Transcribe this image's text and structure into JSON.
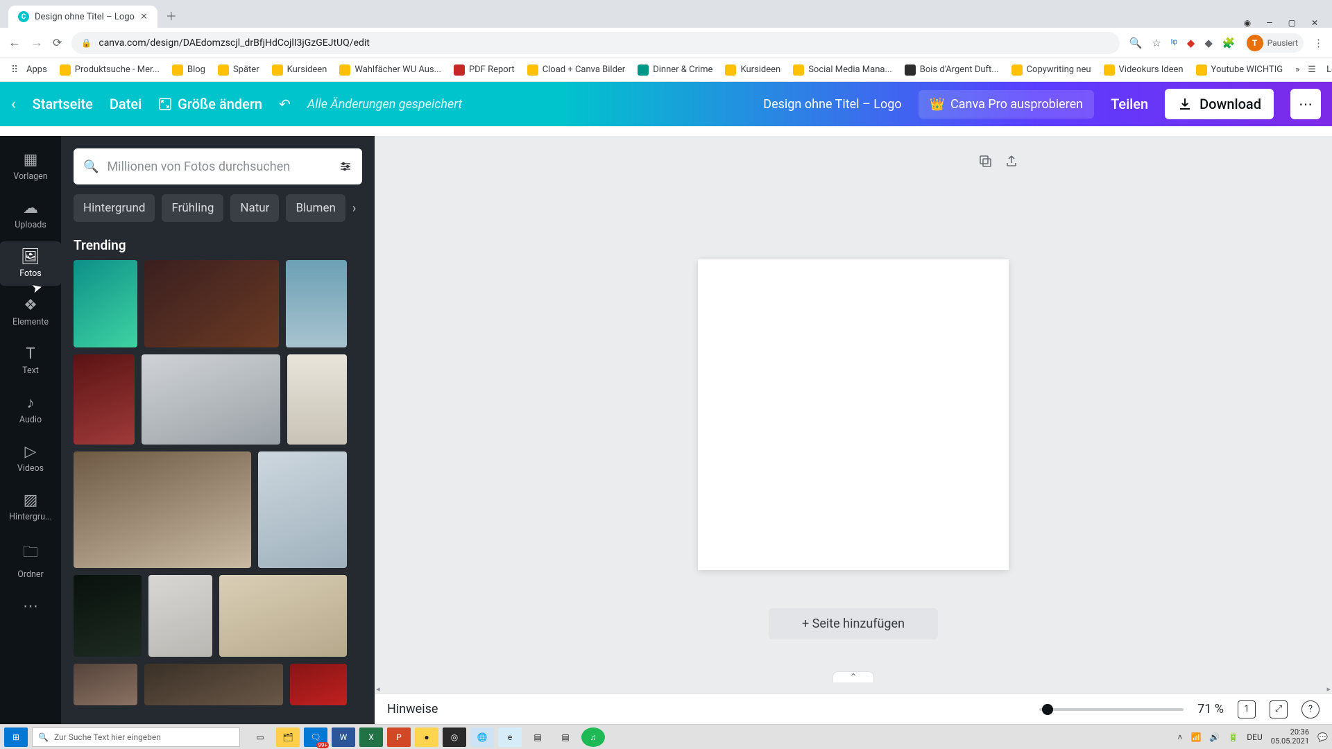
{
  "browser": {
    "tab_title": "Design ohne Titel – Logo",
    "url": "canva.com/design/DAEdomzscjl_drBfjHdCojlI3jGzGEJtUQ/edit",
    "profile_state": "Pausiert",
    "profile_initial": "T",
    "bookmarks": [
      "Apps",
      "Produktsuche - Mer...",
      "Blog",
      "Später",
      "Kursideen",
      "Wahlfächer WU Aus...",
      "PDF Report",
      "Cload + Canva Bilder",
      "Dinner & Crime",
      "Kursideen",
      "Social Media Mana...",
      "Bois d'Argent Duft...",
      "Copywriting neu",
      "Videokurs Ideen",
      "Youtube WICHTIG"
    ],
    "reading_list": "Leseliste"
  },
  "appbar": {
    "home": "Startseite",
    "file": "Datei",
    "resize": "Größe ändern",
    "saved": "Alle Änderungen gespeichert",
    "title": "Design ohne Titel – Logo",
    "try_pro": "Canva Pro ausprobieren",
    "share": "Teilen",
    "download": "Download"
  },
  "rail": {
    "items": [
      "Vorlagen",
      "Uploads",
      "Fotos",
      "Elemente",
      "Text",
      "Audio",
      "Videos",
      "Hintergru...",
      "Ordner"
    ]
  },
  "panel": {
    "search_placeholder": "Millionen von Fotos durchsuchen",
    "chips": [
      "Hintergrund",
      "Frühling",
      "Natur",
      "Blumen"
    ],
    "section": "Trending"
  },
  "canvas": {
    "add_page": "+ Seite hinzufügen",
    "hints": "Hinweise",
    "zoom": "71 %",
    "page_indicator": "1"
  },
  "taskbar": {
    "search_placeholder": "Zur Suche Text hier eingeben",
    "lang": "DEU",
    "time": "20:36",
    "date": "05.05.2021",
    "notif_count": "99+"
  }
}
